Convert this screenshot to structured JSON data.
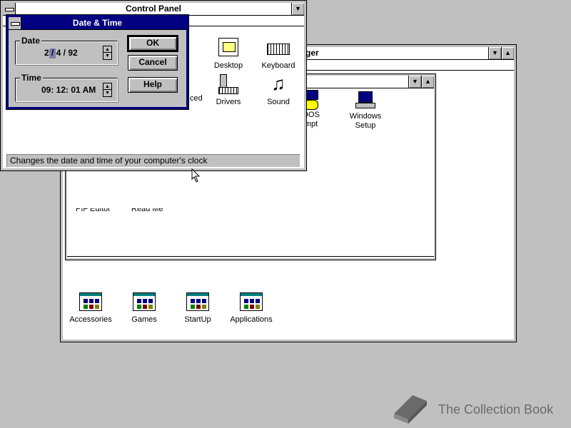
{
  "control_panel": {
    "title": "Control Panel",
    "icons": [
      {
        "label": "Desktop",
        "icon": "desktop-icon"
      },
      {
        "label": "Keyboard",
        "icon": "keyboard-icon"
      },
      {
        "label": "Drivers",
        "icon": "drivers-icon"
      },
      {
        "label": "Sound",
        "icon": "sound-icon"
      }
    ],
    "partial_label_advanced": "ced",
    "status": "Changes the date and time of your computer's clock"
  },
  "date_time_dialog": {
    "title": "Date & Time",
    "date_label": "Date",
    "date_value": "2 / 4 / 92",
    "time_label": "Time",
    "time_value": "09: 12: 01 AM",
    "ok": "OK",
    "cancel": "Cancel",
    "help": "Help"
  },
  "program_manager": {
    "title_partial": "ger",
    "groups": [
      "Accessories",
      "Games",
      "StartUp",
      "Applications"
    ]
  },
  "main_group": {
    "icons": [
      {
        "label_line1": "DOS",
        "label_line2": "mpt",
        "icon": "ms-dos-prompt-icon"
      },
      {
        "label_line1": "Windows",
        "label_line2": "Setup",
        "icon": "windows-setup-icon"
      }
    ],
    "partial_labels": [
      "PIF Editor",
      "Read Me"
    ]
  },
  "watermark": {
    "text": "The Collection Book",
    "icon": "book-icon"
  },
  "colors": {
    "desktop": "#c0c0c0",
    "active_title": "#000080",
    "window": "#ffffff"
  }
}
